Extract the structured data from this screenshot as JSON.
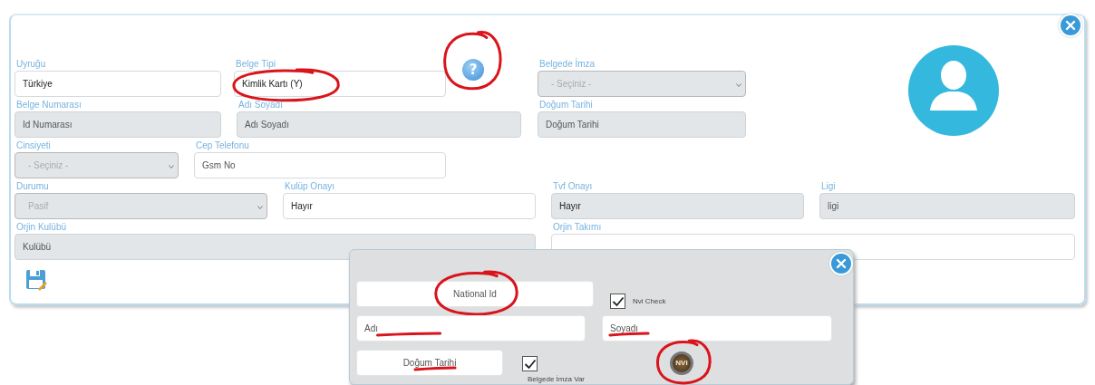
{
  "main": {
    "upper_rows": [
      [
        {
          "kind": "text",
          "label": "Uyruğu",
          "value": "Türkiye",
          "disabled": false
        },
        {
          "kind": "text",
          "label": "Belge Tipi",
          "value": "Kimlik Kartı (Y)",
          "disabled": false,
          "circled": true
        },
        {
          "kind": "select",
          "label": "Belgede İmza",
          "value": "- Seçiniz -",
          "disabled": true
        }
      ],
      [
        {
          "kind": "text",
          "label": "Belge Numarası",
          "placeholder": "Id Numarası",
          "disabled": true
        },
        {
          "kind": "text",
          "label": "Adı Soyadı",
          "placeholder": "Adı Soyadı",
          "disabled": true
        },
        {
          "kind": "text",
          "label": "Doğum Tarihi",
          "placeholder": "Doğum Tarihi",
          "disabled": true
        }
      ],
      [
        {
          "kind": "select",
          "label": "Cinsiyeti",
          "value": "- Seçiniz -",
          "disabled": true
        },
        {
          "kind": "text",
          "label": "Cep Telefonu",
          "placeholder": "Gsm No",
          "disabled": false
        }
      ]
    ],
    "lower_rows": [
      [
        {
          "kind": "select",
          "label": "Durumu",
          "value": "Pasif",
          "disabled": true
        },
        {
          "kind": "text",
          "label": "Kulüp Onayı",
          "value": "Hayır",
          "disabled": false
        },
        {
          "kind": "text",
          "label": "Tvf Onayı",
          "value": "Hayır",
          "disabled": true
        },
        {
          "kind": "text",
          "label": "Ligi",
          "placeholder": "ligi",
          "disabled": true
        }
      ],
      [
        {
          "kind": "text",
          "label": "Orjin Kulübü",
          "placeholder": "Kulübü",
          "disabled": true,
          "colspan": 2
        },
        {
          "kind": "text",
          "label": "Orjin Takımı",
          "disabled": false,
          "colspan": 2
        }
      ]
    ],
    "help_button": {
      "label": "?",
      "circled": true
    }
  },
  "popup": {
    "rows": [
      [
        {
          "kind": "text",
          "placeholder": "National Id",
          "circled": true
        },
        {
          "kind": "check",
          "label": "Nvi Check",
          "checked": true
        }
      ],
      [
        {
          "kind": "text",
          "placeholder": "Adı",
          "underlined": true
        },
        {
          "kind": "text",
          "placeholder": "Soyadı",
          "underlined": true
        }
      ],
      [
        {
          "kind": "text",
          "placeholder": "Doğum Tarihi",
          "underlined": true
        },
        {
          "kind": "check",
          "label": "Belgede İmza Var",
          "checked": true
        },
        {
          "kind": "nvi",
          "label": "NVI",
          "circled": true
        }
      ]
    ]
  }
}
